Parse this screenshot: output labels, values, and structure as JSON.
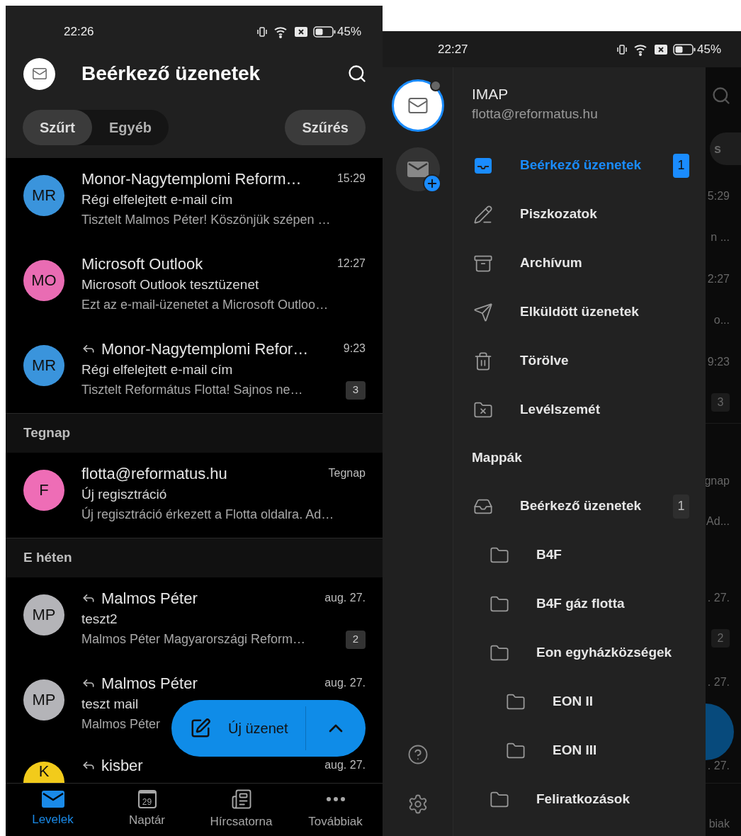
{
  "inbox_screen": {
    "status_bar": {
      "time": "22:26",
      "battery": "45%"
    },
    "header": {
      "title": "Beérkező üzenetek"
    },
    "filter_tabs": [
      {
        "label": "Szűrt",
        "selected": true
      },
      {
        "label": "Egyéb",
        "selected": false
      }
    ],
    "filter_button": "Szűrés",
    "sections": [
      {
        "messages": [
          {
            "initials": "MR",
            "color": "#3a94dc",
            "sender": "Monor-Nagytemplomi Reform…",
            "time": "15:29",
            "replied": false,
            "subject": "Régi elfelejtett e-mail cím",
            "preview": "Tisztelt Malmos Péter! Köszönjük szépen …"
          },
          {
            "initials": "MO",
            "color": "#e96cb3",
            "sender": "Microsoft Outlook",
            "time": "12:27",
            "replied": false,
            "subject": "Microsoft Outlook tesztüzenet",
            "preview": "Ezt az e-mail-üzenetet a Microsoft Outloo…"
          },
          {
            "initials": "MR",
            "color": "#3a94dc",
            "sender": "Monor-Nagytemplomi Refor…",
            "time": "9:23",
            "replied": true,
            "subject": "Régi elfelejtett e-mail cím",
            "preview": "Tisztelt Református Flotta! Sajnos ne…",
            "count": "3"
          }
        ]
      },
      {
        "heading": "Tegnap",
        "messages": [
          {
            "initials": "F",
            "color": "#ee6db6",
            "sender": "flotta@reformatus.hu",
            "time": "Tegnap",
            "replied": false,
            "subject": "Új regisztráció",
            "preview": "Új regisztráció érkezett a Flotta oldalra. Ad…"
          }
        ]
      },
      {
        "heading": "E héten",
        "messages": [
          {
            "initials": "MP",
            "color": "#b4b4b8",
            "sender": "Malmos Péter",
            "time": "aug. 27.",
            "replied": true,
            "subject": "teszt2",
            "preview": "Malmos Péter Magyarországi Reform…",
            "count": "2"
          },
          {
            "initials": "MP",
            "color": "#b4b4b8",
            "sender": "Malmos Péter",
            "time": "aug. 27.",
            "replied": true,
            "subject": "teszt mail",
            "preview": "Malmos Péter"
          },
          {
            "initials": "K",
            "color": "#f2cb1b",
            "sender": "kisber",
            "time": "aug. 27.",
            "replied": true
          }
        ]
      }
    ],
    "compose_button": "Új üzenet",
    "bottom_nav": [
      {
        "label": "Levelek",
        "kind": "mail",
        "selected": true
      },
      {
        "label": "Naptár",
        "kind": "calendar",
        "icon_text": "29",
        "selected": false
      },
      {
        "label": "Hírcsatorna",
        "kind": "feed",
        "selected": false
      },
      {
        "label": "Továbbiak",
        "kind": "more",
        "selected": false
      }
    ]
  },
  "drawer_screen": {
    "status_bar": {
      "time": "22:27",
      "battery": "45%"
    },
    "account": {
      "name": "IMAP",
      "email": "flotta@reformatus.hu"
    },
    "favorites": [
      {
        "label": "Beérkező üzenetek",
        "kind": "inbox",
        "selected": true,
        "count": "1"
      },
      {
        "label": "Piszkozatok",
        "kind": "drafts",
        "selected": false
      },
      {
        "label": "Archívum",
        "kind": "archive",
        "selected": false
      },
      {
        "label": "Elküldött üzenetek",
        "kind": "sent",
        "selected": false
      },
      {
        "label": "Törölve",
        "kind": "trash",
        "selected": false
      },
      {
        "label": "Levélszemét",
        "kind": "junk",
        "selected": false
      }
    ],
    "folders_heading": "Mappák",
    "folders": [
      {
        "label": "Beérkező üzenetek",
        "kind": "inbox",
        "count": "1",
        "children": [
          {
            "label": "B4F",
            "kind": "folder"
          },
          {
            "label": "B4F gáz flotta",
            "kind": "folder"
          },
          {
            "label": "Eon egyházközségek",
            "kind": "folder",
            "children": [
              {
                "label": "EON II",
                "kind": "folder"
              },
              {
                "label": "EON III",
                "kind": "folder"
              }
            ]
          },
          {
            "label": "Feliratkozások",
            "kind": "folder"
          }
        ]
      }
    ],
    "behind_drawer": [
      {
        "kind": "pill",
        "text": "s"
      },
      {
        "kind": "text",
        "text": "5:29"
      },
      {
        "kind": "text",
        "text": "n ..."
      },
      {
        "kind": "text",
        "text": "2:27"
      },
      {
        "kind": "text",
        "text": "o..."
      },
      {
        "kind": "text",
        "text": "9:23"
      },
      {
        "kind": "badge",
        "text": "3"
      },
      {
        "kind": "text",
        "text": "gnap"
      },
      {
        "kind": "text",
        "text": "Ad..."
      },
      {
        "kind": "text",
        "text": ". 27."
      },
      {
        "kind": "badge",
        "text": "2"
      },
      {
        "kind": "text",
        "text": ". 27."
      },
      {
        "kind": "text",
        "text": ". 27."
      },
      {
        "kind": "text",
        "text": "biak"
      }
    ]
  }
}
